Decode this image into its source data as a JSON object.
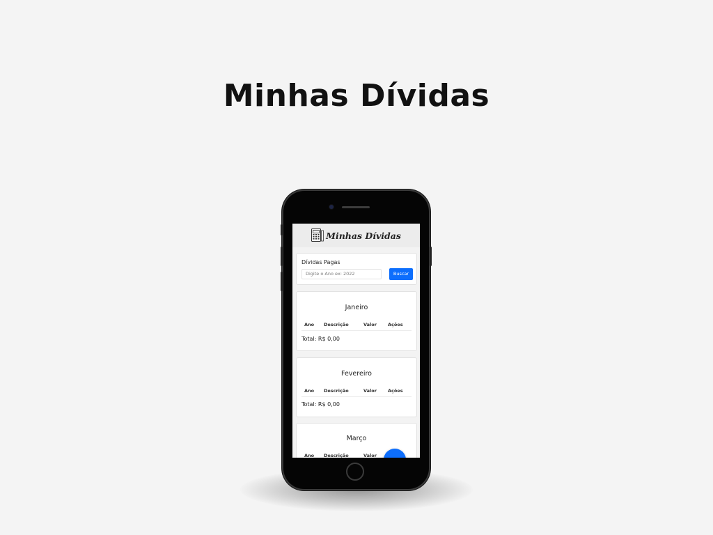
{
  "page": {
    "title": "Minhas Dívidas"
  },
  "app": {
    "brand": "Minhas Dívidas",
    "icon": "calculator-icon"
  },
  "search": {
    "title": "Dívidas Pagas",
    "placeholder": "Digite o Ano ex: 2022",
    "button_label": "Buscar"
  },
  "table_columns": [
    "Ano",
    "Descrição",
    "Valor",
    "Ações"
  ],
  "months": [
    {
      "name": "Janeiro",
      "total_label": "Total: R$ 0,00"
    },
    {
      "name": "Fevereiro",
      "total_label": "Total: R$ 0,00"
    },
    {
      "name": "Março"
    }
  ],
  "colors": {
    "accent": "#0d6efd",
    "background": "#f4f4f4"
  }
}
